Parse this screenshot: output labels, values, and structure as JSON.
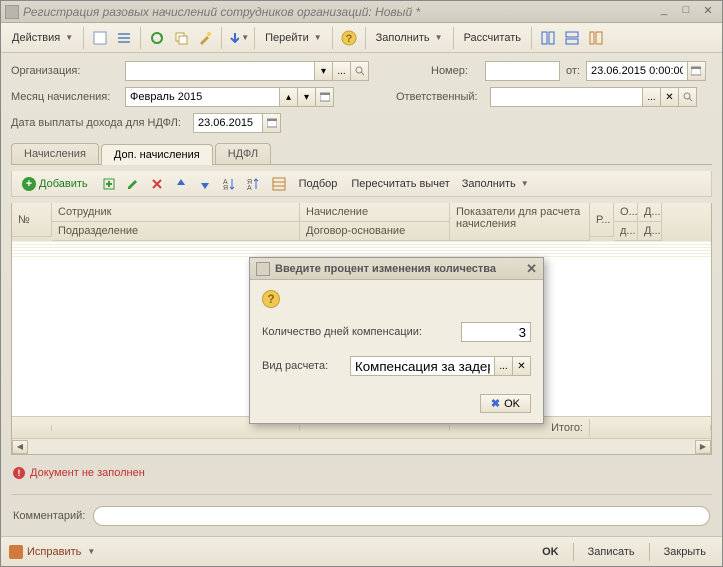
{
  "window_title": "Регистрация разовых начислений сотрудников организаций: Новый *",
  "toolbar": {
    "actions": "Действия",
    "goto": "Перейти",
    "fill": "Заполнить",
    "calc": "Рассчитать"
  },
  "form": {
    "org_label": "Организация:",
    "org_value": "",
    "month_label": "Месяц начисления:",
    "month_value": "Февраль 2015",
    "ndfl_date_label": "Дата выплаты дохода для НДФЛ:",
    "ndfl_date_value": "23.06.2015",
    "number_label": "Номер:",
    "number_value": "",
    "from_label": "от:",
    "date_value": "23.06.2015 0:00:00",
    "responsible_label": "Ответственный:",
    "responsible_value": ""
  },
  "tabs": {
    "tab1": "Начисления",
    "tab2": "Доп. начисления",
    "tab3": "НДФЛ"
  },
  "subtoolbar": {
    "add": "Добавить",
    "selection": "Подбор",
    "recalc": "Пересчитать вычет",
    "fill": "Заполнить"
  },
  "grid": {
    "col_n": "№",
    "col_employee": "Сотрудник",
    "col_subdiv": "Подразделение",
    "col_accrual": "Начисление",
    "col_contract": "Договор-основание",
    "col_indicators": "Показатели для расчета начисления",
    "col_r": "Р...",
    "col_o": "О...",
    "col_d1": "Д...",
    "col_dn": "д...",
    "col_d2": "Д...",
    "footer_total": "Итого:"
  },
  "status_text": "Документ не заполнен",
  "comment_label": "Комментарий:",
  "footer": {
    "fix": "Исправить",
    "ok": "OK",
    "write": "Записать",
    "close": "Закрыть"
  },
  "dialog": {
    "title": "Введите процент  изменения количества",
    "days_label": "Количество дней компенсации:",
    "days_value": "3",
    "calc_type_label": "Вид расчета:",
    "calc_type_value": "Компенсация за задер:",
    "ok": "OK"
  }
}
